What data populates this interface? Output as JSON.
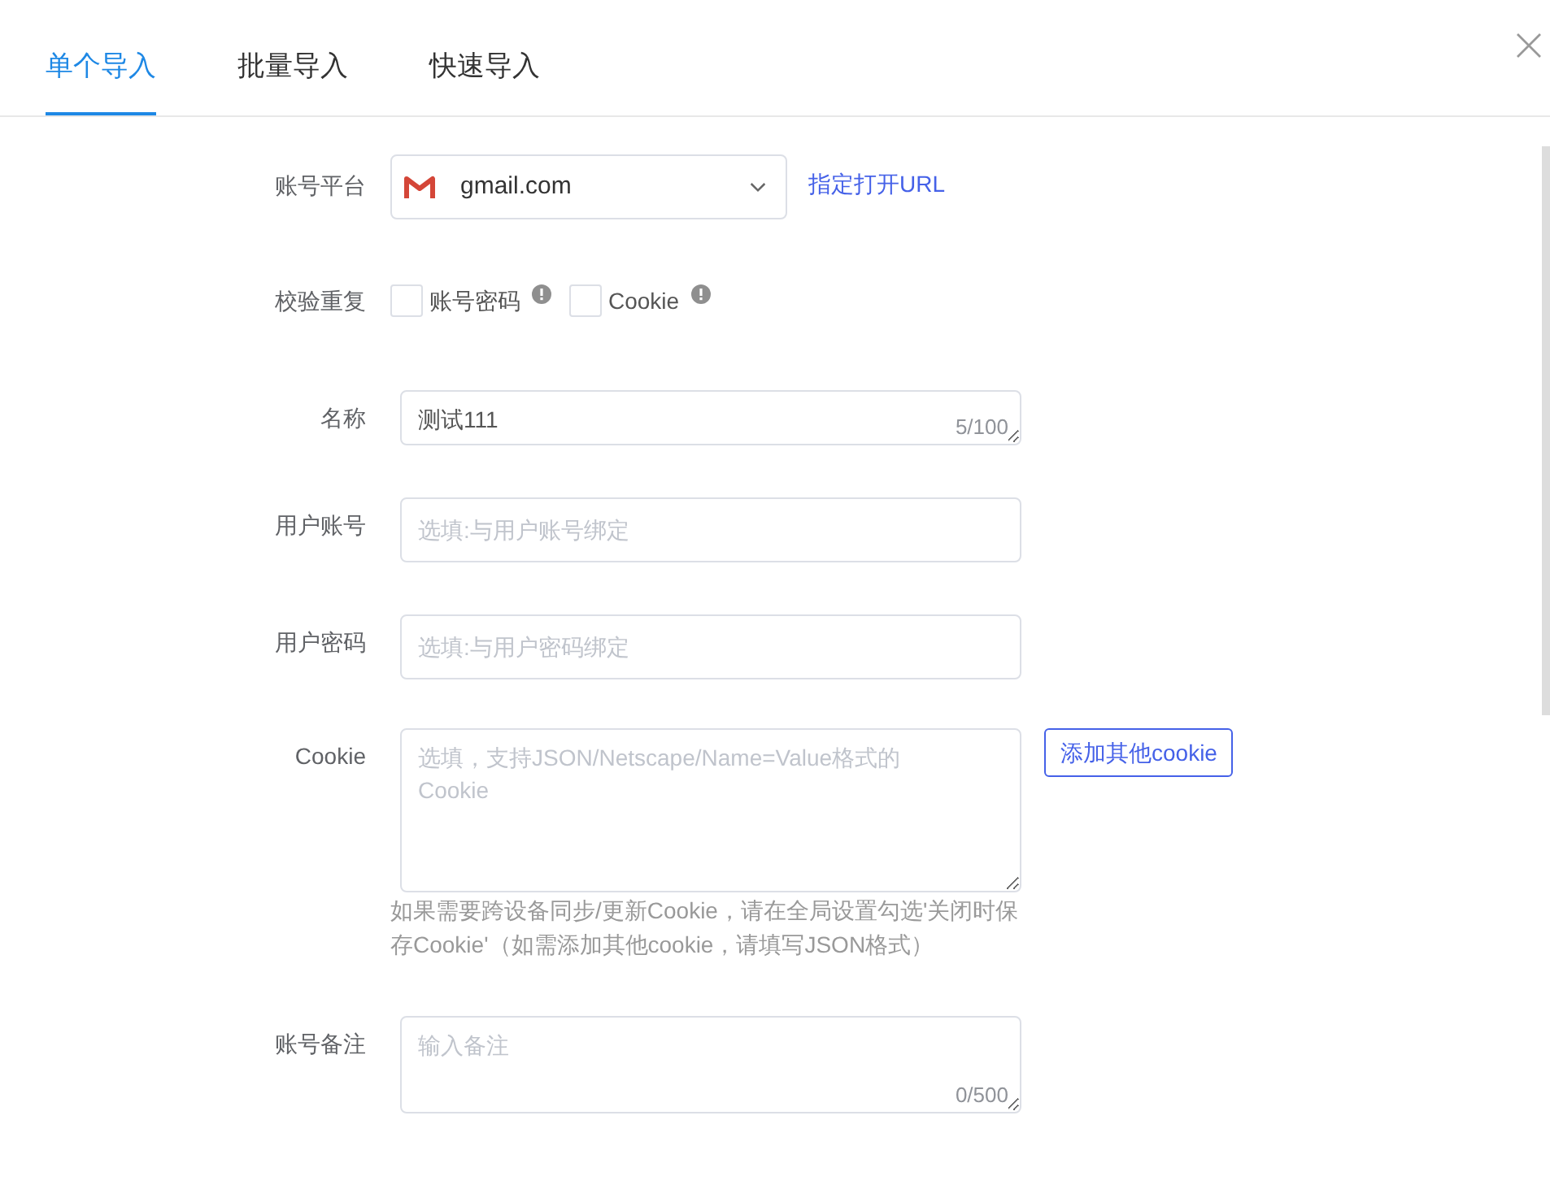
{
  "tabs": [
    {
      "label": "单个导入",
      "selected": true
    },
    {
      "label": "批量导入",
      "selected": false
    },
    {
      "label": "快速导入",
      "selected": false
    }
  ],
  "form": [
    {
      "kind": "select",
      "label": "账号平台",
      "value": "gmail.com",
      "link": "指定打开URL"
    },
    {
      "kind": "checks",
      "label": "校验重复",
      "options": [
        {
          "label": "账号密码",
          "checked": false
        },
        {
          "label": "Cookie",
          "checked": false
        }
      ]
    },
    {
      "kind": "name",
      "label": "名称",
      "value": "测试111",
      "counter": "5/100"
    },
    {
      "kind": "input",
      "label": "用户账号",
      "placeholder": "选填:与用户账号绑定"
    },
    {
      "kind": "input",
      "label": "用户密码",
      "placeholder": "选填:与用户密码绑定"
    },
    {
      "kind": "cookie",
      "label": "Cookie",
      "placeholder": "选填，支持JSON/Netscape/Name=Value格式的Cookie",
      "button": "添加其他cookie",
      "hint": "如果需要跨设备同步/更新Cookie，请在全局设置勾选'关闭时保存Cookie'（如需添加其他cookie，请填写JSON格式）"
    },
    {
      "kind": "note",
      "label": "账号备注",
      "placeholder": "输入备注",
      "counter": "0/500"
    }
  ]
}
